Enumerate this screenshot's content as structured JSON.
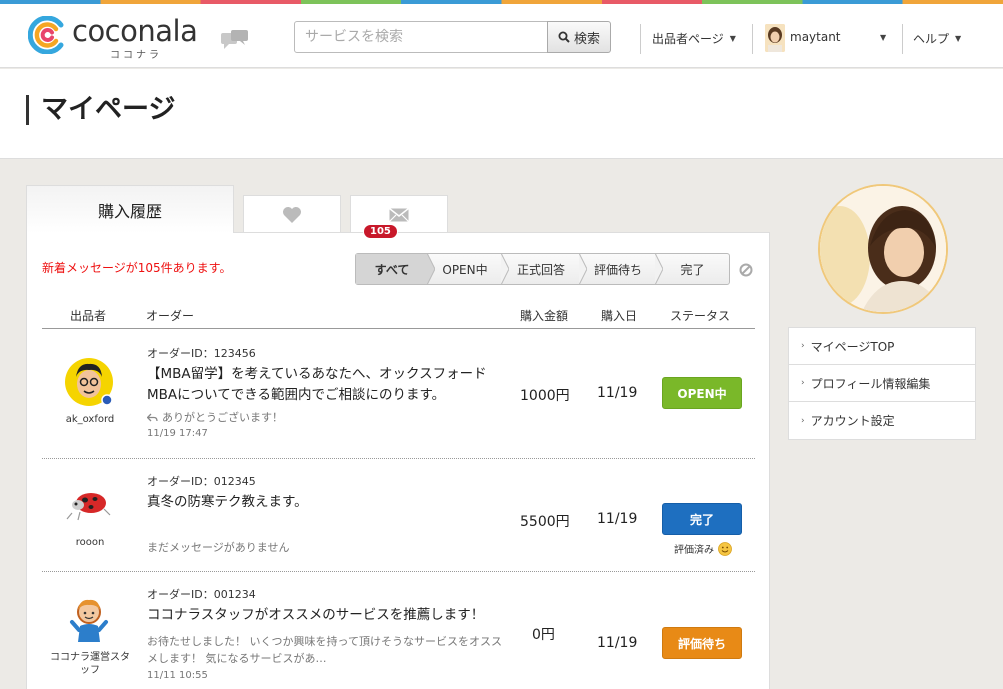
{
  "header": {
    "logo_text": "coconala",
    "logo_kana": "ココナラ",
    "search_placeholder": "サービスを検索",
    "search_button": "検索",
    "nav_seller": "出品者ページ",
    "nav_user": "maytant",
    "nav_help": "ヘルプ"
  },
  "page": {
    "title": "マイページ"
  },
  "tabs": {
    "history": "購入履歴"
  },
  "notice": "新着メッセージが105件あります。",
  "filters": {
    "items": [
      "すべて",
      "OPEN中",
      "正式回答",
      "評価待ち",
      "完了"
    ],
    "badge": "105"
  },
  "table": {
    "headers": [
      "出品者",
      "オーダー",
      "購入金額",
      "購入日",
      "ステータス"
    ],
    "rows": [
      {
        "seller": "ak_oxford",
        "order_id": "オーダーID：123456",
        "title": "【MBA留学】を考えているあなたへ、オックスフォードMBAについてできる範囲内でご相談にのります。",
        "message": "ありがとうございます！",
        "time": "11/19 17:47",
        "price": "1000円",
        "date": "11/19",
        "status": "OPEN中"
      },
      {
        "seller": "rooon",
        "order_id": "オーダーID：012345",
        "title": "真冬の防寒テク教えます。",
        "message": "まだメッセージがありません",
        "time": "",
        "price": "5500円",
        "date": "11/19",
        "status": "完了",
        "eval_note": "評価済み"
      },
      {
        "seller": "ココナラ運営スタッフ",
        "order_id": "オーダーID：001234",
        "title": "ココナラスタッフがオススメのサービスを推薦します！",
        "message": "お待たせしました！ いくつか興味を持って頂けそうなサービスをオススメします！ 気になるサービスがあ…",
        "time": "11/11 10:55",
        "price": "0円",
        "date": "11/19",
        "status": "評価待ち"
      }
    ]
  },
  "sidebar": {
    "items": [
      "マイページTOP",
      "プロフィール情報編集",
      "アカウント設定"
    ]
  },
  "colors": {
    "open": "#7ab829",
    "done": "#1e6fc0",
    "wait": "#e88a16",
    "notice": "#ee1111",
    "badge": "#c8182a"
  }
}
